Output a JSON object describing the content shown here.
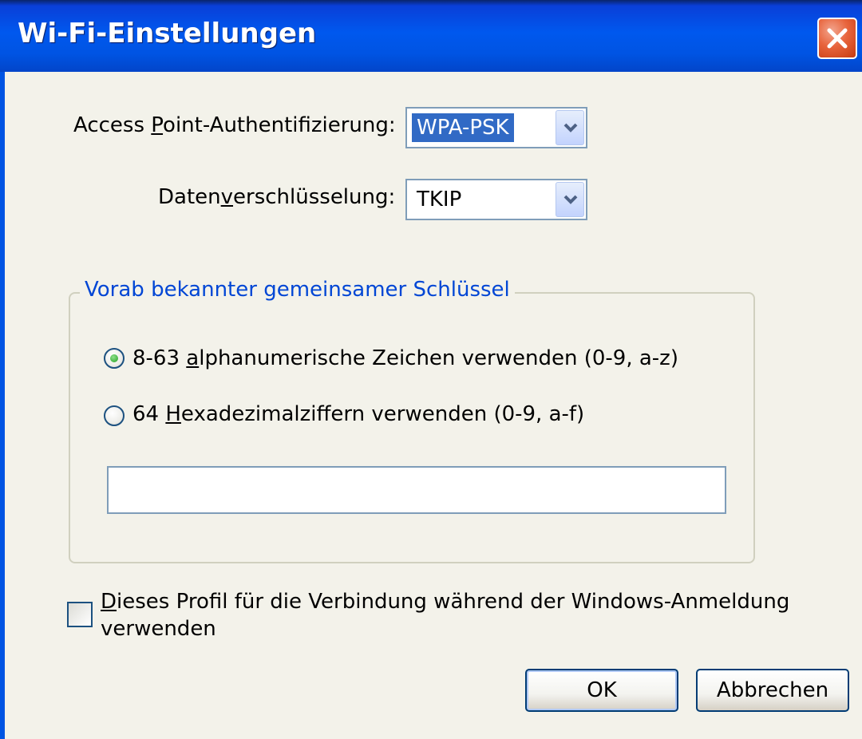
{
  "window": {
    "title": "Wi-Fi-Einstellungen",
    "close_icon": "close-icon"
  },
  "auth": {
    "label_pre": "Access ",
    "label_mnemonic": "P",
    "label_post": "oint-Authentifizierung:",
    "selected": "WPA-PSK"
  },
  "encryption": {
    "label_pre": "Daten",
    "label_mnemonic": "v",
    "label_post": "erschlüsselung:",
    "selected": "TKIP"
  },
  "psk_group": {
    "title": "Vorab bekannter gemeinsamer Schlüssel",
    "options": [
      {
        "pre": "8-63 ",
        "mnemonic": "a",
        "post": "lphanumerische Zeichen verwenden (0-9, a-z)",
        "checked": true
      },
      {
        "pre": "64 ",
        "mnemonic": "H",
        "post": "exadezimalziffern verwenden (0-9, a-f)",
        "checked": false
      }
    ],
    "key_value": ""
  },
  "logon_checkbox": {
    "mnemonic": "D",
    "line1_post": "ieses Profil für die Verbindung während der Windows-Anmeldung",
    "line2": "verwenden",
    "checked": false
  },
  "buttons": {
    "ok": "OK",
    "cancel": "Abbrechen"
  },
  "colors": {
    "title_bar": "#0054e3",
    "close_button": "#e8643c",
    "group_title": "#0046d5",
    "selection": "#316ac5",
    "background": "#f3f2ea"
  }
}
